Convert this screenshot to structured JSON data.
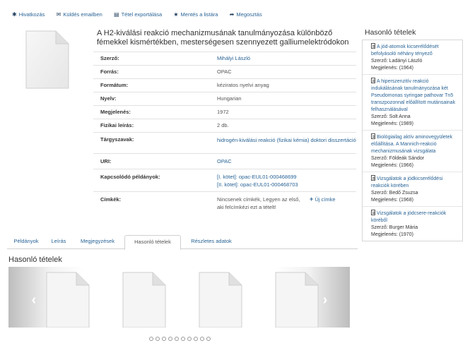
{
  "toolbar": {
    "items": [
      {
        "icon": "asterisk-icon",
        "label": "Hivatkozás"
      },
      {
        "icon": "envelope-icon",
        "label": "Küldés emailben"
      },
      {
        "icon": "list-icon",
        "label": "Tétel exportálása"
      },
      {
        "icon": "star-icon",
        "label": "Mentés a listára"
      },
      {
        "icon": "share-icon",
        "label": "Megosztás"
      }
    ]
  },
  "record": {
    "title": "A H2-kiválási reakció mechanizmusának tanulmányozása különböző fémekkel kismértékben, mesterségesen szennyezett galliumelektródokon",
    "fields": {
      "szerzo": {
        "label": "Szerző:",
        "value": "Mihályi László"
      },
      "forras": {
        "label": "Forrás:",
        "value": "OPAC"
      },
      "formatum": {
        "label": "Formátum:",
        "value": "kéziratos nyelvi anyag"
      },
      "nyelv": {
        "label": "Nyelv:",
        "value": "Hungarian"
      },
      "megjelenes": {
        "label": "Megjelenés:",
        "value": "1972"
      },
      "fizikai": {
        "label": "Fizikai leírás:",
        "value": "2 db."
      },
      "targyszavak": {
        "label": "Tárgyszavak:",
        "value": "hidrogén-kiválási reakció (fizikai kémia) doktori disszertáció"
      },
      "uri": {
        "label": "URI:",
        "value": "OPAC"
      },
      "kapcsolodo": {
        "label": "Kapcsolódó példányok:",
        "line1": "[I. kötet]: opac-EUL01-000468699",
        "line2": "[II. kötet]: opac-EUL01-000468703"
      },
      "cimkek": {
        "label": "Címkék:",
        "value": "Nincsenek címkék, Legyen az első, aki felcímkézi ezt a tételt!",
        "add_label": "Új címke"
      }
    }
  },
  "tabs": [
    "Példányok",
    "Leírás",
    "Megjegyzések",
    "Hasonló tételek",
    "Részletes adatok"
  ],
  "active_tab": "Hasonló tételek",
  "similar": {
    "title": "Hasonló tételek",
    "dots_count": 10
  },
  "sidebar": {
    "title": "Hasonló tételek",
    "items": [
      {
        "title": "A jód-atomok kicserélődését befolyásoló néhány tényező",
        "author": "Szerző: Ladányi László",
        "date": "Megjelenés: (1964)"
      },
      {
        "title": "A hiperszenzitív reakció indukálásának tanulmányozása két Pseudomonas syringae pathovar Tn5 transzpozonnal előállított mutánsainak felhasználásával",
        "author": "Szerző: Solt Anna",
        "date": "Megjelenés: (1989)"
      },
      {
        "title": "Biológiailag aktív aminovegyületek előállítása. A Mannich-reakció mechanizmusának vizsgálata",
        "author": "Szerző: Földeák Sándor",
        "date": "Megjelenés: (1966)"
      },
      {
        "title": "Vizsgálatok a jódkicserélődési reakciók körében",
        "author": "Szerző: Bedő Zsuzsa",
        "date": "Megjelenés: (1968)"
      },
      {
        "title": "Vizsgálatok a jódcsere-reakciók köréből",
        "author": "Szerző: Burger Mária",
        "date": "Megjelenés: (1970)"
      }
    ]
  }
}
